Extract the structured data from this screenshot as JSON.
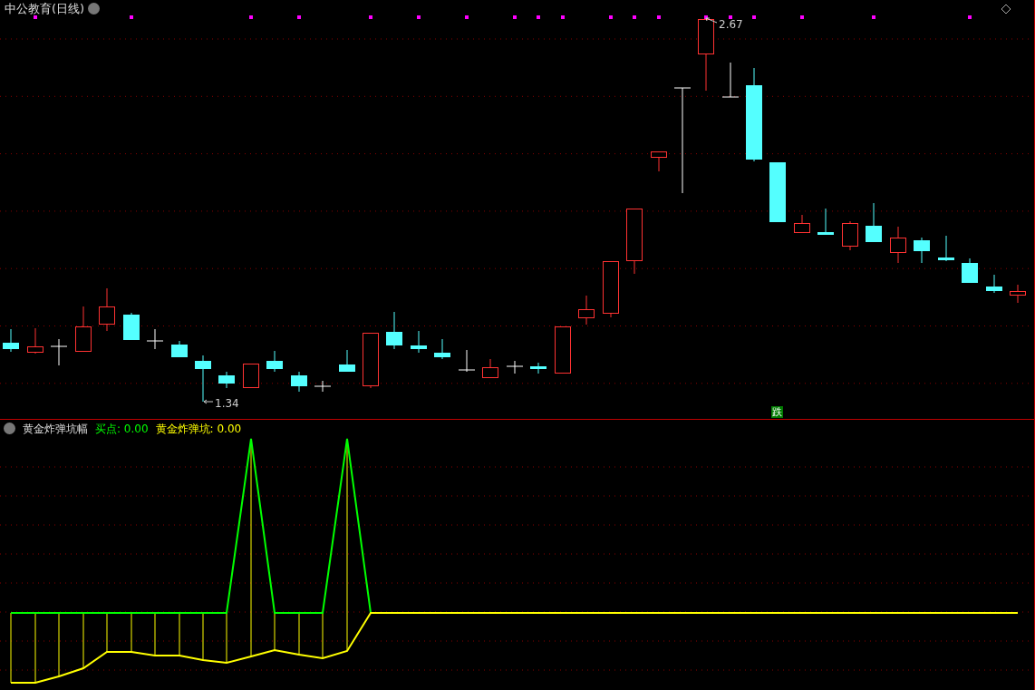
{
  "main_panel": {
    "title": "中公教育(日线)",
    "high_label": "2.67",
    "low_label": "1.34",
    "signal": "跌"
  },
  "indicator_panel": {
    "name": "黄金炸弹坑幅",
    "legend": [
      {
        "label": "买点: 0.00",
        "color": "#00ff00"
      },
      {
        "label": "黄金炸弹坑: 0.00",
        "color": "#ffff00"
      }
    ]
  }
}
